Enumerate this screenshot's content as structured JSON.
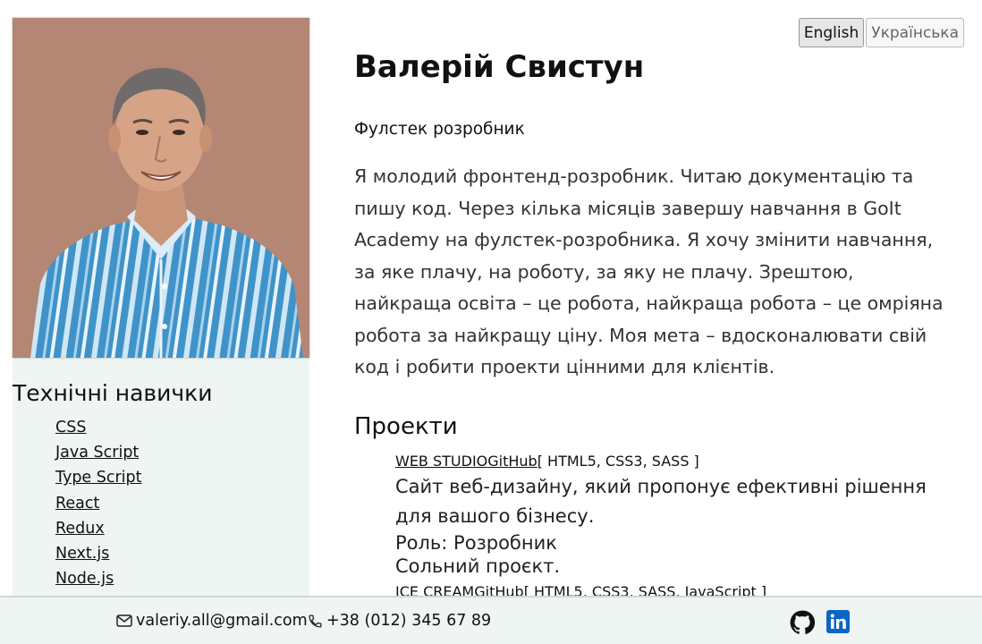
{
  "language_switch": {
    "english": "English",
    "ukrainian": "Українська"
  },
  "profile": {
    "name": "Валерій Свистун",
    "role": "Фулстек розробник",
    "bio": "Я молодий фронтенд-розробник. Читаю документацію та пишу код. Через кілька місяців завершу навчання в GoIt Academy на фулстек-розробника. Я хочу змінити навчання, за яке плачу, на роботу, за яку не плачу. Зрештою, найкраща освіта – це робота, найкраща робота – це омріяна робота за найкращу ціну. Моя мета – вдосконалювати свій код і робити проекти цінними для клієнтів."
  },
  "skills": {
    "title": "Технічні навички",
    "items": [
      "CSS",
      "Java Script",
      "Type Script",
      "React",
      "Redux",
      "Next.js",
      "Node.js"
    ]
  },
  "projects": {
    "title": "Проекти",
    "items": [
      {
        "name": "WEB STUDIO",
        "repo_label": "GitHub",
        "stack": "[ HTML5, CSS3, SASS ]",
        "description": "Сайт веб-дизайну, який пропонує ефективні рішення для вашого бізнесу.",
        "role": "Роль: Розробник",
        "type": "Сольний проєкт."
      },
      {
        "name": "ICE CREAM",
        "repo_label": "GitHub",
        "stack": "[ HTML5, CSS3, SASS, JavaScript ]"
      }
    ]
  },
  "footer": {
    "email": "valeriy.all@gmail.com",
    "phone": "+38 (012) 345 67 89",
    "email_icon": "envelope-icon",
    "phone_icon": "phone-icon",
    "github_icon": "github-icon",
    "linkedin_icon": "linkedin-icon"
  },
  "colors": {
    "sidebar_bg": "#eef5f2",
    "linkedin": "#0a66c2"
  }
}
